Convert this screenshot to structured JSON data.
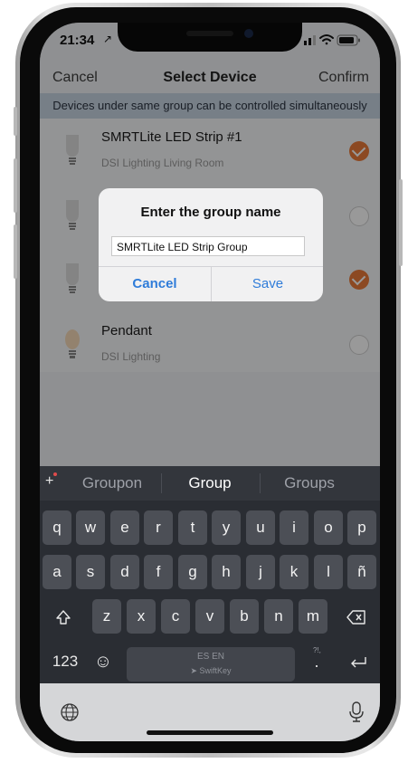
{
  "status_bar": {
    "time": "21:34",
    "location_arrow": "↗"
  },
  "nav": {
    "cancel_label": "Cancel",
    "title": "Select Device",
    "confirm_label": "Confirm"
  },
  "banner": {
    "text": "Devices under same group can be controlled simultaneously"
  },
  "devices": [
    {
      "name": "SMRTLite LED Strip #1",
      "location": "DSI Lighting Living Room",
      "selected": true,
      "icon": "bulb-icon"
    },
    {
      "name": "",
      "location": "",
      "selected": false,
      "icon": "bulb-icon"
    },
    {
      "name": "",
      "location": "",
      "selected": true,
      "icon": "bulb-icon"
    },
    {
      "name": "Pendant",
      "location": "DSI Lighting",
      "selected": false,
      "icon": "pendant-bulb-icon"
    }
  ],
  "dialog": {
    "title": "Enter the group name",
    "input_value": "SMRTLite LED Strip Group",
    "cancel_label": "Cancel",
    "save_label": "Save"
  },
  "keyboard": {
    "suggestions": [
      "Groupon",
      "Group",
      "Groups"
    ],
    "row1": [
      "q",
      "w",
      "e",
      "r",
      "t",
      "y",
      "u",
      "i",
      "o",
      "p"
    ],
    "row2": [
      "a",
      "s",
      "d",
      "f",
      "g",
      "h",
      "j",
      "k",
      "l",
      "ñ"
    ],
    "row3": [
      "z",
      "x",
      "c",
      "v",
      "b",
      "n",
      "m"
    ],
    "numbers_label": "123",
    "space_language": "ES EN",
    "space_brand": "SwiftKey",
    "punct_label": "?!,",
    "emoji_label": "☺"
  },
  "colors": {
    "accent_orange": "#ea7b3a",
    "link_blue": "#2f7cd9",
    "banner_bg": "#c7d4e1",
    "keyboard_bg": "#2a2d33"
  }
}
